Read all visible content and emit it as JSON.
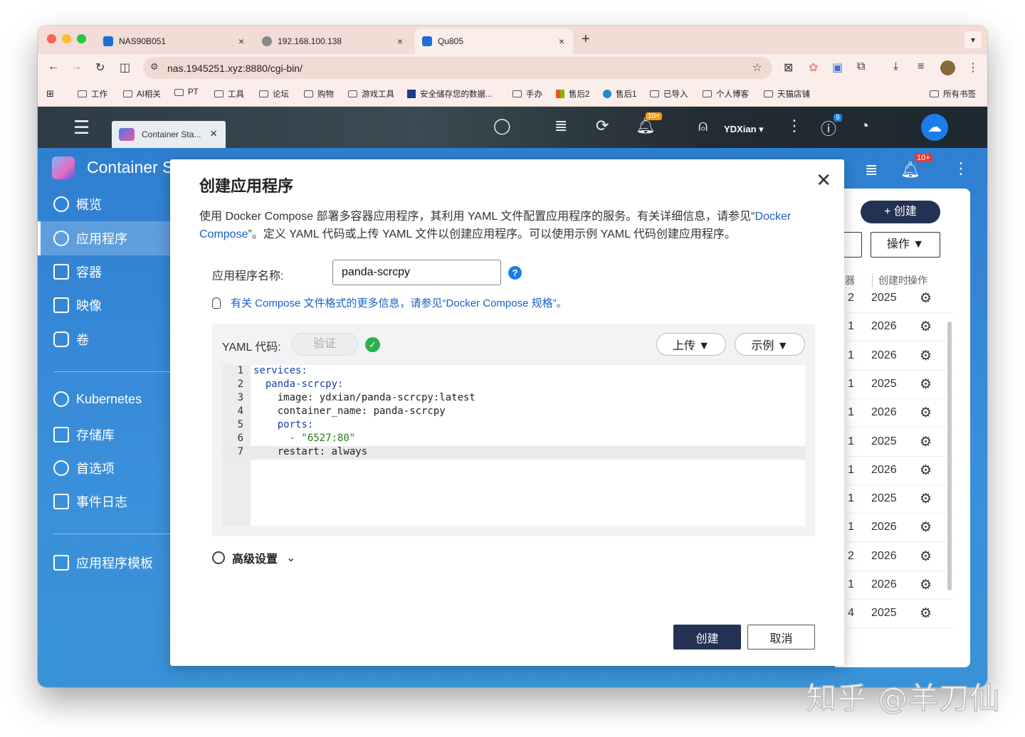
{
  "browser": {
    "tabs": [
      {
        "title": "NAS90B051",
        "icon": "qnap-icon"
      },
      {
        "title": "192.168.100.138",
        "icon": "globe-icon"
      },
      {
        "title": "Qu805",
        "icon": "qnap-icon"
      }
    ],
    "new_tab": "+",
    "url": "nas.1945251.xyz:8880/cgi-bin/",
    "bookmarks": [
      "工作",
      "AI相关",
      "PT",
      "工具",
      "论坛",
      "购物",
      "游戏工具",
      "安全储存您的数据...",
      "手办",
      "售后2",
      "售后1",
      "已导入",
      "个人博客",
      "天猫店铺"
    ],
    "all_bookmarks": "所有书签"
  },
  "qts": {
    "app_tab": "Container Sta...",
    "user": "YDXian ▾",
    "notif_badge": "10+",
    "info_badge": "9"
  },
  "app": {
    "title": "Container S",
    "sidebar": [
      "概览",
      "应用程序",
      "容器",
      "映像",
      "卷",
      "Kubernetes",
      "存储库",
      "首选项",
      "事件日志",
      "应用程序模板"
    ],
    "create_button": "+ 创建",
    "ops_button": "操作 ▼",
    "col_headers": [
      "器",
      "创建时",
      "操作"
    ],
    "notif_badge": "10+",
    "rows": [
      {
        "a": "2",
        "b": "2025"
      },
      {
        "a": "1",
        "b": "2026"
      },
      {
        "a": "1",
        "b": "2026"
      },
      {
        "a": "1",
        "b": "2025"
      },
      {
        "a": "1",
        "b": "2026"
      },
      {
        "a": "1",
        "b": "2025"
      },
      {
        "a": "1",
        "b": "2026"
      },
      {
        "a": "1",
        "b": "2025"
      },
      {
        "a": "1",
        "b": "2026"
      },
      {
        "a": "2",
        "b": "2026"
      },
      {
        "a": "1",
        "b": "2026"
      },
      {
        "a": "4",
        "b": "2025"
      }
    ]
  },
  "modal": {
    "title": "创建应用程序",
    "desc_1": "使用 Docker Compose 部署多容器应用程序，其利用 YAML 文件配置应用程序的服务。有关详细信息，请参见“",
    "desc_link": "Docker Compose",
    "desc_2": "”。定义 YAML 代码或上传 YAML 文件以创建应用程序。可以使用示例 YAML 代码创建应用程序。",
    "name_label": "应用程序名称:",
    "name_value": "panda-scrcpy",
    "info_text": "有关 Compose 文件格式的更多信息，请参见“Docker Compose 规格”。",
    "yaml_label": "YAML 代码:",
    "validate": "验证",
    "upload": "上传 ▼",
    "example": "示例 ▼",
    "code_lines": [
      "services:",
      "  panda-scrcpy:",
      "    image: ydxian/panda-scrcpy:latest",
      "    container_name: panda-scrcpy",
      "    ports:",
      "      - \"6527:80\"",
      "    restart: always"
    ],
    "advanced": "高级设置",
    "create": "创建",
    "cancel": "取消"
  },
  "watermark": "知乎 @羊刀仙"
}
